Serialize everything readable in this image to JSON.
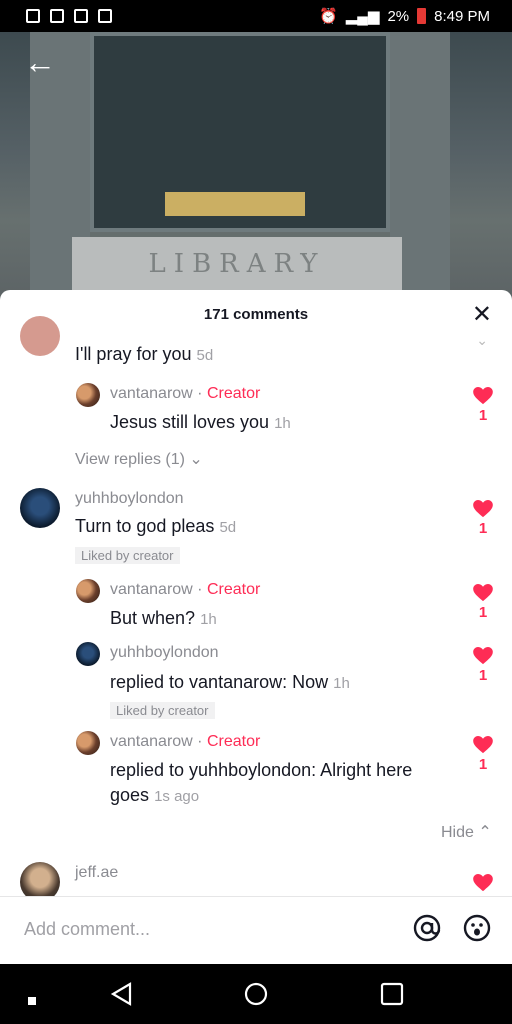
{
  "status_bar": {
    "battery": "2%",
    "time": "8:49 PM"
  },
  "video": {
    "sign_text": "LIBRARY"
  },
  "comments_sheet": {
    "title": "171 comments",
    "comments": [
      {
        "text": "I'll pray for you",
        "time": "5d"
      },
      {
        "user": "vantanarow",
        "badge": "Creator",
        "text": "Jesus still loves you",
        "time": "1h",
        "likes": "1"
      },
      {
        "view_replies": "View replies (1)"
      },
      {
        "user": "yuhhboylondon",
        "text": "Turn to god pleas",
        "time": "5d",
        "likes": "1",
        "liked_by": "Liked by creator"
      },
      {
        "user": "vantanarow",
        "badge": "Creator",
        "text": "But when?",
        "time": "1h",
        "likes": "1"
      },
      {
        "user": "yuhhboylondon",
        "text": "replied to vantanarow: Now",
        "time": "1h",
        "likes": "1",
        "liked_by": "Liked by creator"
      },
      {
        "user": "vantanarow",
        "badge": "Creator",
        "text_line1": "replied to yuhhboylondon: Alright here",
        "text_line2": "goes",
        "time": "1s ago",
        "likes": "1"
      },
      {
        "hide": "Hide"
      },
      {
        "user": "jeff.ae"
      }
    ]
  },
  "composer": {
    "placeholder": "Add comment..."
  }
}
